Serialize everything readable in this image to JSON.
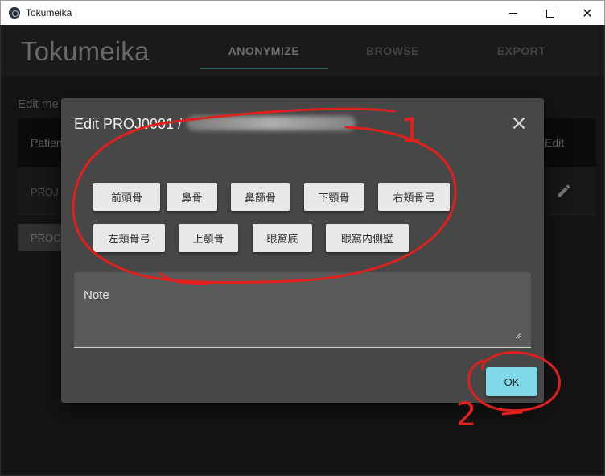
{
  "window": {
    "title": "Tokumeika"
  },
  "app": {
    "brand": "Tokumeika",
    "tabs": [
      "ANONYMIZE",
      "BROWSE",
      "EXPORT"
    ],
    "active_tab": "ANONYMIZE",
    "accent_color": "#5aa7a7"
  },
  "page": {
    "title": "Edit me",
    "table": {
      "headers": {
        "patient": "Patien",
        "edit": "Edit"
      },
      "rows": [
        {
          "patient": "PROJ"
        }
      ]
    },
    "process_button": "PROC"
  },
  "dialog": {
    "title": "Edit PROJ0001 /",
    "chips": [
      "前頭骨",
      "鼻骨",
      "鼻篩骨",
      "下顎骨",
      "右頬骨弓",
      "左頬骨弓",
      "上顎骨",
      "眼窩底",
      "眼窩内側壁"
    ],
    "note_label": "Note",
    "note_value": "",
    "ok_label": "OK",
    "ok_color": "#7fd9e7"
  },
  "annotations": {
    "label_1": "1",
    "label_2": "2",
    "color": "#e0201c"
  },
  "icons": {
    "close": "close-icon",
    "edit": "pencil-icon",
    "resize": "resize-handle-icon"
  }
}
